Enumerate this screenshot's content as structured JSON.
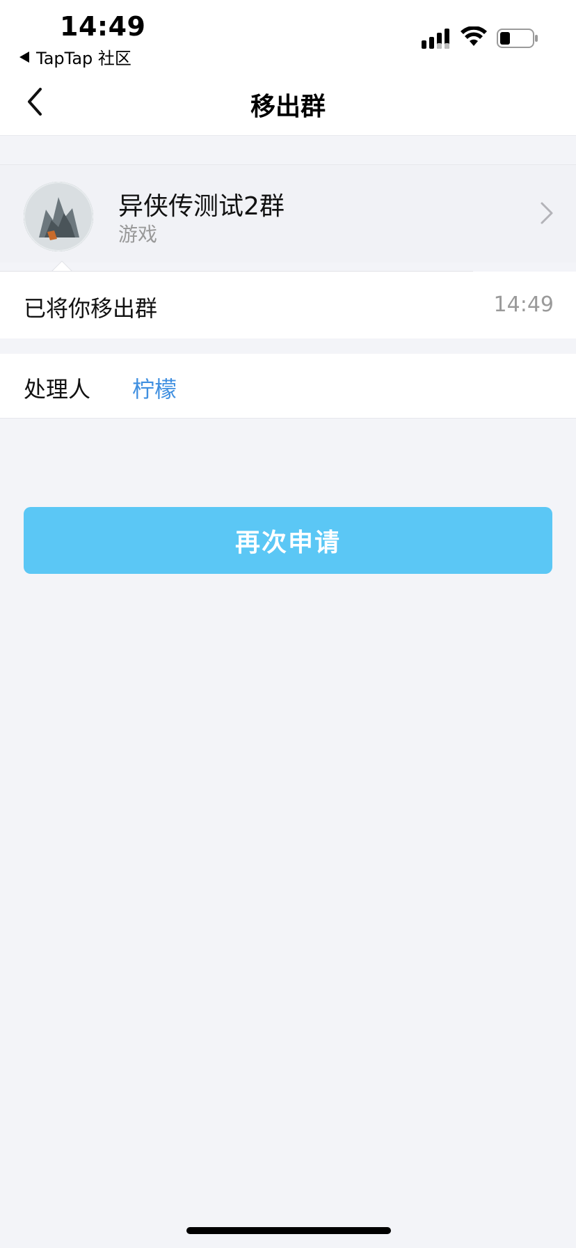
{
  "status_bar": {
    "time": "14:49",
    "back_app": "TapTap 社区"
  },
  "header": {
    "title": "移出群"
  },
  "group": {
    "name": "异侠传测试2群",
    "type": "游戏"
  },
  "message": {
    "text": "已将你移出群",
    "time": "14:49"
  },
  "handler": {
    "label": "处理人",
    "name": "柠檬"
  },
  "actions": {
    "reapply_label": "再次申请"
  },
  "colors": {
    "accent_button": "#5bc7f5",
    "link": "#3f8fe0",
    "background": "#f3f4f8"
  }
}
